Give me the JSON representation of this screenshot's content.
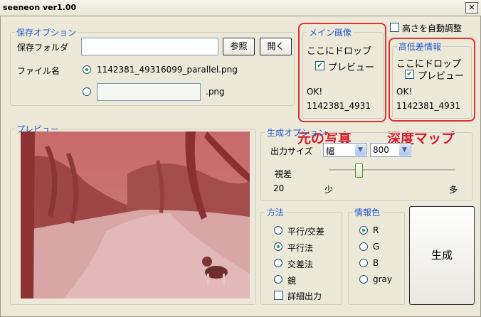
{
  "window": {
    "title": "seeneon ver1.00",
    "close_glyph": "✕"
  },
  "save": {
    "legend": "保存オプション",
    "folder_label": "保存フォルダ",
    "folder_value": "",
    "browse_label": "参照",
    "open_label": "開く",
    "filename_label": "ファイル名",
    "option1": "1142381_49316099_parallel.png",
    "option2_value": "",
    "option2_ext": ".png"
  },
  "auto_height": {
    "label": "高さを自動調整",
    "checked": false
  },
  "main_image": {
    "legend": "メイン画像",
    "drop": "ここにドロップ",
    "preview_label": "プレビュー",
    "status": "OK!",
    "file": "1142381_4931"
  },
  "height_info": {
    "legend": "高低差情報",
    "drop": "ここにドロップ",
    "preview_label": "プレビュー",
    "status": "OK!",
    "file": "1142381_4931"
  },
  "preview": {
    "legend": "プレビュー"
  },
  "gen": {
    "legend": "生成オプション",
    "size_label": "出力サイズ",
    "size_dim": "幅",
    "size_value": "800",
    "parallax_label": "視差",
    "parallax_value": "20",
    "slider_fraction": 0.23,
    "min_label": "少",
    "max_label": "多"
  },
  "method": {
    "legend": "方法",
    "options": [
      "平行/交差",
      "平行法",
      "交差法",
      "鏡"
    ],
    "selected": 1,
    "detail_label": "詳細出力"
  },
  "info_color": {
    "legend": "情報色",
    "options": [
      "R",
      "G",
      "B",
      "gray"
    ],
    "selected": 0
  },
  "generate_label": "生成",
  "overlay_text": {
    "left": "元の写真",
    "right": "深度マップ"
  },
  "colors": {
    "legend": "#2159cf",
    "annotation": "#e03030",
    "accent_check": "#1b8a1b"
  }
}
